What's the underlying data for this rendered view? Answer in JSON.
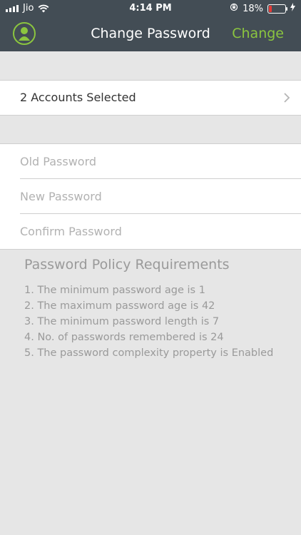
{
  "status_bar": {
    "carrier": "Jio",
    "time": "4:14 PM",
    "battery": "18%",
    "battery_level": 0.18
  },
  "header": {
    "title": "Change Password",
    "action_label": "Change"
  },
  "accounts": {
    "label": "2 Accounts Selected"
  },
  "fields": {
    "old_password": {
      "value": "",
      "placeholder": "Old Password"
    },
    "new_password": {
      "value": "",
      "placeholder": "New Password"
    },
    "confirm_password": {
      "value": "",
      "placeholder": "Confirm Password"
    }
  },
  "policy": {
    "heading": "Password Policy Requirements",
    "items": [
      "1. The minimum password age is 1",
      "2. The maximum password age is 42",
      "3. The minimum password length is 7",
      "4. No. of passwords remembered is 24",
      "5. The password complexity property is Enabled"
    ]
  },
  "colors": {
    "header_bg": "#434d55",
    "accent": "#8bc53f",
    "page_bg": "#e6e6e6",
    "battery_low": "#e53935"
  },
  "icons": {
    "avatar": "user-avatar-icon",
    "wifi": "wifi-icon",
    "signal": "signal-icon",
    "lock_rotation": "orientation-lock-icon",
    "charging": "charging-bolt-icon",
    "chevron": "chevron-right-icon"
  }
}
